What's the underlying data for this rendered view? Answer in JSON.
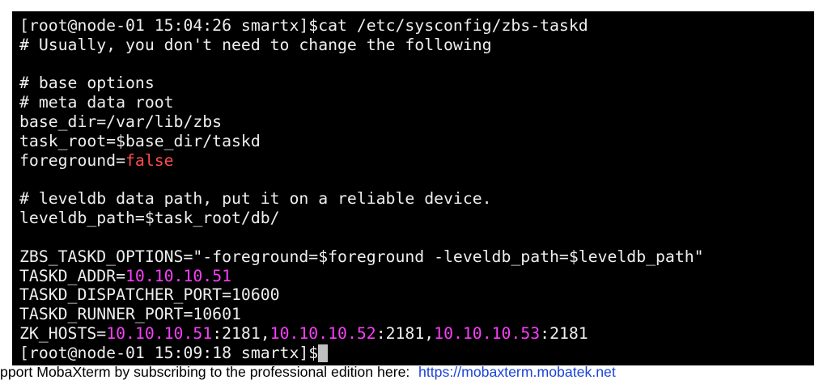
{
  "terminal": {
    "first_prompt": "[root@node-01 15:04:26 smartx]$",
    "command": "cat /etc/sysconfig/zbs-taskd",
    "file_lines": [
      {
        "text": "# Usually, you don't need to change the following"
      },
      {
        "text": "# base options"
      },
      {
        "text": "# meta data root"
      },
      {
        "text": "base_dir=/var/lib/zbs"
      },
      {
        "text": "task_root=$base_dir/taskd"
      },
      {
        "key": "foreground=",
        "value": "false"
      },
      {
        "text": "# leveldb data path, put it on a reliable device."
      },
      {
        "text": "leveldb_path=$task_root/db/"
      },
      {
        "text": "ZBS_TASKD_OPTIONS=\"-foreground=$foreground -leveldb_path=$leveldb_path\""
      },
      {
        "key": "TASKD_ADDR=",
        "value": "10.10.10.51"
      },
      {
        "text": "TASKD_DISPATCHER_PORT=10600"
      },
      {
        "text": "TASKD_RUNNER_PORT=10601"
      },
      {
        "key": "ZK_HOSTS=",
        "hosts": [
          {
            "ip": "10.10.10.51",
            "suffix": ":2181,"
          },
          {
            "ip": "10.10.10.52",
            "suffix": ":2181,"
          },
          {
            "ip": "10.10.10.53",
            "suffix": ":2181"
          }
        ]
      }
    ],
    "current_prompt": "[root@node-01 15:09:18 smartx]$"
  },
  "status_bar": {
    "message": "pport MobaXterm by subscribing to the professional edition here:",
    "link": "https://mobaxterm.mobatek.net"
  },
  "colors": {
    "window_background": "#ffffff",
    "terminal_background": "#000000",
    "terminal_foreground": "#eeeeee",
    "boolean_value": "#ff4d4d",
    "ip_address": "#f93ef9",
    "cursor": "#c0c0c0",
    "status_text": "#000000",
    "link": "#1c44d4"
  }
}
